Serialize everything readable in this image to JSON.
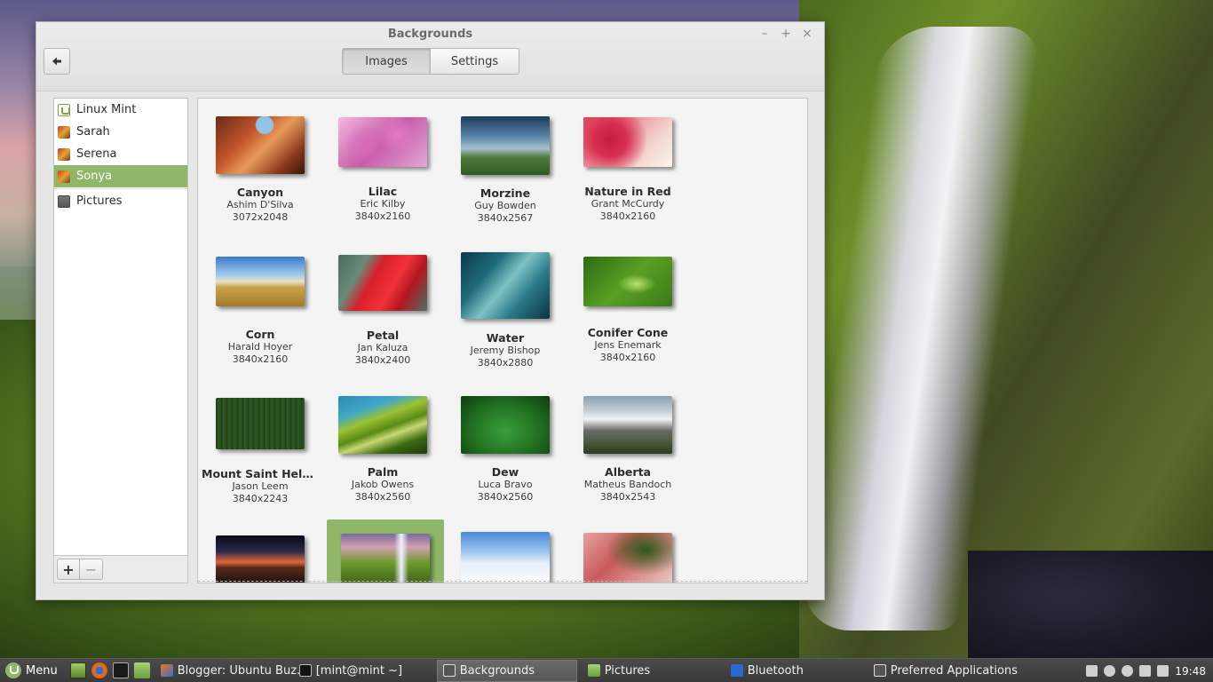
{
  "window": {
    "title": "Backgrounds",
    "controls": {
      "minimize": "–",
      "maximize": "+",
      "close": "×"
    },
    "tabs": [
      {
        "label": "Images",
        "active": true
      },
      {
        "label": "Settings",
        "active": false
      }
    ]
  },
  "sidebar": {
    "items": [
      {
        "label": "Linux Mint",
        "icon": "linux-mint-icon"
      },
      {
        "label": "Sarah",
        "icon": "picture-folder-icon"
      },
      {
        "label": "Serena",
        "icon": "picture-folder-icon"
      },
      {
        "label": "Sonya",
        "icon": "picture-folder-icon",
        "selected": true
      },
      {
        "label": "Pictures",
        "icon": "camera-folder-icon"
      }
    ],
    "add_label": "+",
    "remove_label": "−"
  },
  "gallery": {
    "items": [
      {
        "name": "Canyon",
        "author": "Ashim D'Silva",
        "size": "3072x2048"
      },
      {
        "name": "Lilac",
        "author": "Eric Kilby",
        "size": "3840x2160"
      },
      {
        "name": "Morzine",
        "author": "Guy Bowden",
        "size": "3840x2567"
      },
      {
        "name": "Nature in Red",
        "author": "Grant McCurdy",
        "size": "3840x2160"
      },
      {
        "name": "Corn",
        "author": "Harald Hoyer",
        "size": "3840x2160"
      },
      {
        "name": "Petal",
        "author": "Jan Kaluza",
        "size": "3840x2400"
      },
      {
        "name": "Water",
        "author": "Jeremy Bishop",
        "size": "3840x2880"
      },
      {
        "name": "Conifer Cone",
        "author": "Jens Enemark",
        "size": "3840x2160"
      },
      {
        "name": "Mount Saint Hele...",
        "author": "Jason Leem",
        "size": "3840x2243"
      },
      {
        "name": "Palm",
        "author": "Jakob Owens",
        "size": "3840x2560"
      },
      {
        "name": "Dew",
        "author": "Luca Bravo",
        "size": "3840x2560"
      },
      {
        "name": "Alberta",
        "author": "Matheus Bandoch",
        "size": "3840x2543"
      }
    ],
    "selected_index": 13
  },
  "taskbar": {
    "menu_label": "Menu",
    "tasks": [
      {
        "label": "Blogger: Ubuntu Buz...",
        "icon": "firefox-icon"
      },
      {
        "label": "[mint@mint ~]",
        "icon": "terminal-icon"
      },
      {
        "label": "Backgrounds",
        "icon": "backgrounds-icon",
        "active": true
      },
      {
        "label": "Pictures",
        "icon": "folder-icon"
      },
      {
        "label": "Bluetooth",
        "icon": "bluetooth-icon"
      },
      {
        "label": "Preferred Applications",
        "icon": "preferences-icon"
      }
    ],
    "clock": "19:48"
  },
  "colors": {
    "accent": "#8fb669",
    "taskbar": "#3a3a3a"
  }
}
